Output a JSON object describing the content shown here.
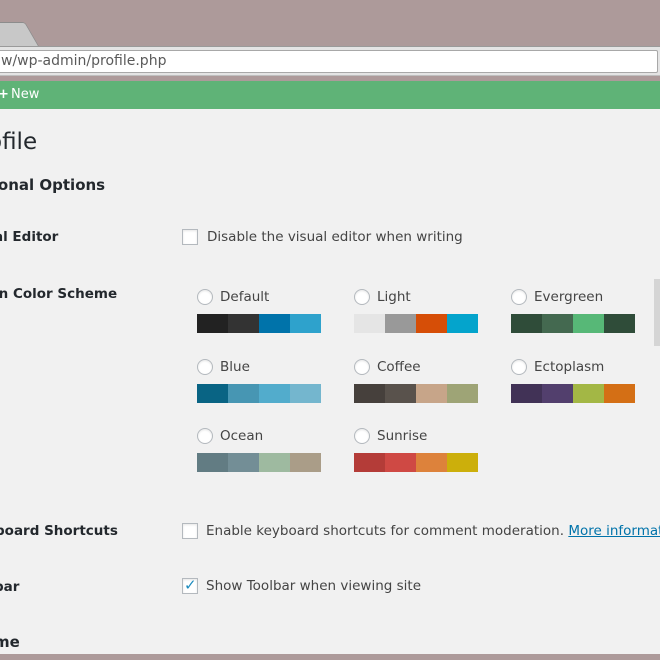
{
  "browser": {
    "address": "w/wp-admin/profile.php"
  },
  "admin_bar": {
    "plus": "+",
    "new_label": "New"
  },
  "page": {
    "title": "ofile",
    "section": "sonal Options",
    "visual_editor": {
      "label": "al Editor",
      "option": "Disable the visual editor when writing",
      "checked": false
    },
    "color_scheme": {
      "label": "in Color Scheme",
      "schemes": [
        {
          "name": "Default",
          "colors": [
            "#222222",
            "#333333",
            "#0073aa",
            "#2ea2cc"
          ]
        },
        {
          "name": "Light",
          "colors": [
            "#e5e5e5",
            "#999999",
            "#d64e07",
            "#04a4cc"
          ]
        },
        {
          "name": "Evergreen",
          "colors": [
            "#2f4c39",
            "#446950",
            "#57b877",
            "#2f4c39"
          ]
        },
        {
          "name": "Blue",
          "colors": [
            "#096484",
            "#4796b3",
            "#52accc",
            "#74b6ce"
          ]
        },
        {
          "name": "Coffee",
          "colors": [
            "#46403c",
            "#59524c",
            "#c7a589",
            "#9ea476"
          ]
        },
        {
          "name": "Ectoplasm",
          "colors": [
            "#413256",
            "#523f6d",
            "#a3b745",
            "#d46f15"
          ]
        },
        {
          "name": "Ocean",
          "colors": [
            "#627c83",
            "#738e96",
            "#9ebaa0",
            "#aa9d88"
          ]
        },
        {
          "name": "Sunrise",
          "colors": [
            "#b43c38",
            "#cf4944",
            "#dd823b",
            "#ccaf0b"
          ]
        }
      ]
    },
    "keyboard_shortcuts": {
      "label": "board Shortcuts",
      "option": "Enable keyboard shortcuts for comment moderation.",
      "link": "More information",
      "checked": false
    },
    "toolbar": {
      "label": "bar",
      "option": "Show Toolbar when viewing site",
      "checked": true,
      "check_glyph": "✓"
    },
    "next_section": "me"
  }
}
